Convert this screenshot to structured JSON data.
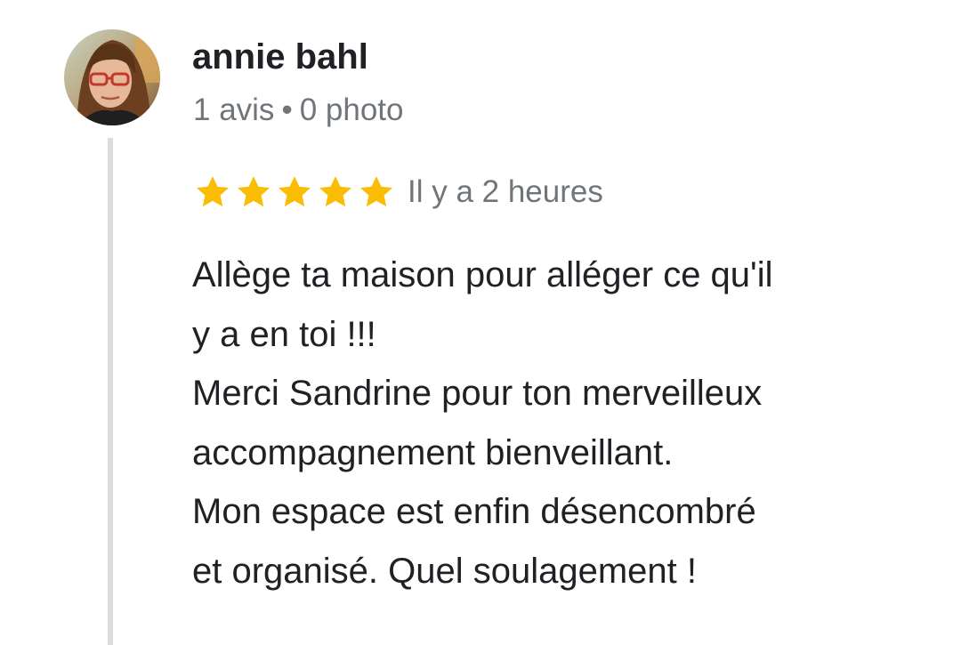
{
  "reviewer": {
    "name": "annie bahl",
    "reviews_count": "1 avis",
    "separator": "•",
    "photos_count": "0 photo"
  },
  "review": {
    "rating": 5,
    "max_rating": 5,
    "star_color": "#fbbc04",
    "time_ago": "Il y a 2 heures",
    "text_lines": [
      "Allège ta maison pour alléger ce qu'il",
      "y a en toi !!!",
      "Merci Sandrine pour ton merveilleux",
      "accompagnement bienveillant.",
      "Mon espace est enfin désencombré",
      "et organisé. Quel soulagement !"
    ]
  },
  "colors": {
    "name_text": "#202124",
    "meta_text": "#70757a",
    "thread_line": "#dadce0"
  },
  "icons": {
    "avatar": "reviewer-avatar-photo",
    "star": "star-icon"
  }
}
